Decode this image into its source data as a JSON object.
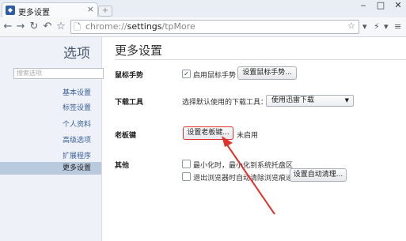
{
  "window": {
    "tab_title": "更多设置",
    "tab_icon": "browser-logo-icon",
    "tab_close": "×",
    "new_tab": "+",
    "min": "‒",
    "max": "□",
    "close": "✕"
  },
  "toolbar": {
    "back": "←",
    "forward": "→",
    "reload": "↻",
    "undo": "↶",
    "home": "☆",
    "url_scheme": "chrome://",
    "url_host": "settings",
    "url_path": "/tpMore",
    "star": "☆",
    "dropdown": "▾",
    "right_icons": [
      "▾",
      "⚡",
      "▾",
      "≡"
    ]
  },
  "sidebar": {
    "title": "选项",
    "search_placeholder": "搜索选项",
    "items": [
      {
        "label": "基本设置"
      },
      {
        "label": "标签设置"
      },
      {
        "label": "个人资料"
      },
      {
        "label": "高级选项"
      },
      {
        "label": "扩展程序"
      },
      {
        "label": "更多设置"
      }
    ]
  },
  "main": {
    "title": "更多设置",
    "mouse_gesture": {
      "label": "鼠标手势",
      "checkbox_label": "启用鼠标手势",
      "checked": true,
      "button": "设置鼠标手势..."
    },
    "download": {
      "label": "下载工具",
      "prompt": "选择默认使用的下载工具：",
      "selected": "使用迅雷下载"
    },
    "boss_key": {
      "label": "老板键",
      "button": "设置老板键...",
      "status": "未启用"
    },
    "other": {
      "label": "其他",
      "option1": "最小化时，最小化到系统托盘区",
      "option2": "退出浏览器时自动清除浏览痕迹",
      "button": "设置自动清理..."
    }
  },
  "colors": {
    "accent_link": "#3b5f98",
    "annotation_red": "#e0322c",
    "sidebar_bg": "#eef2f8",
    "active_item_bg": "#b9c9de"
  }
}
